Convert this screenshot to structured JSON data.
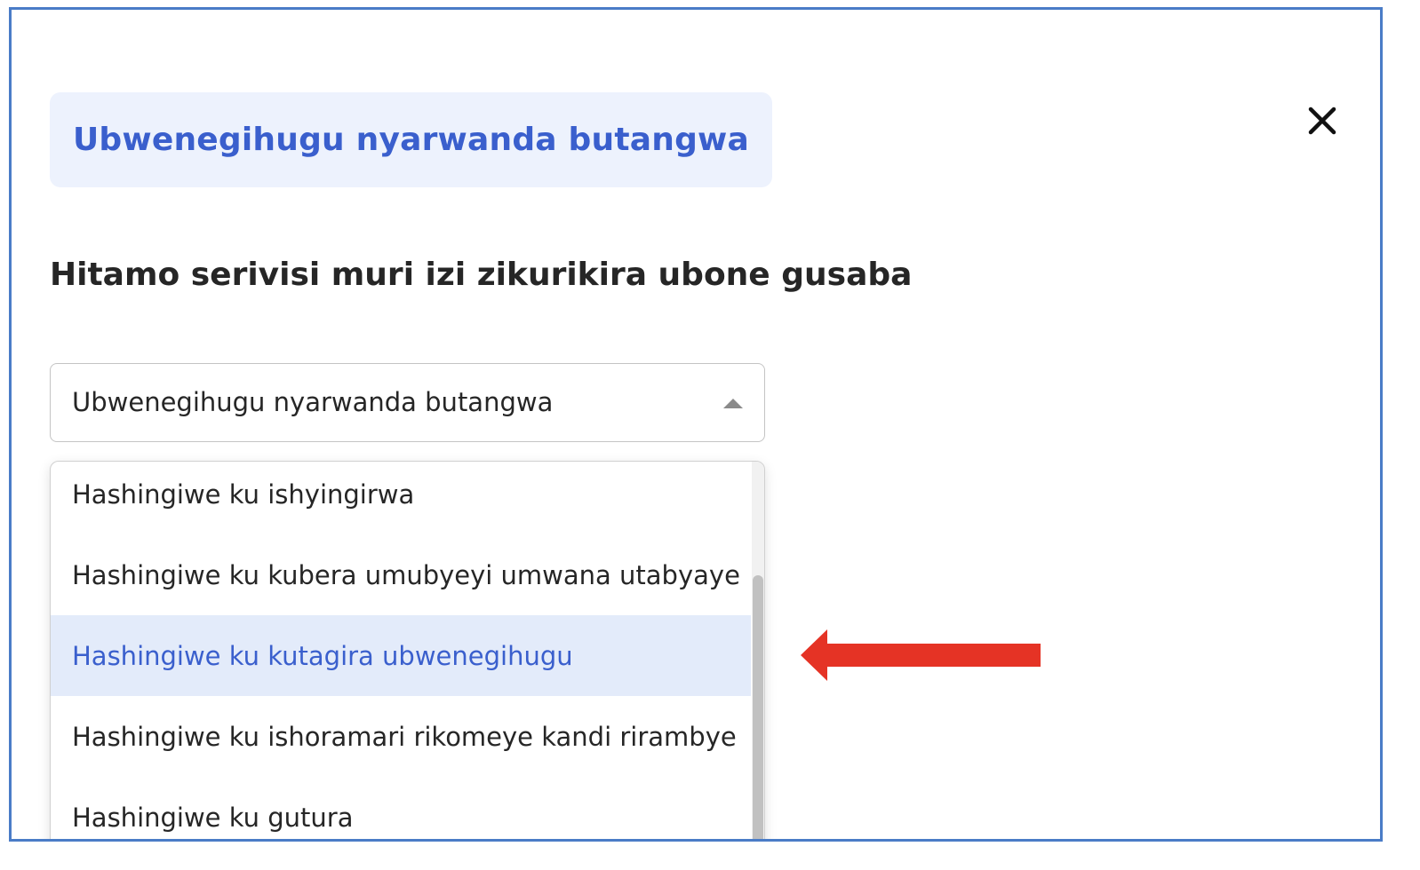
{
  "dialog": {
    "title": "Ubwenegihugu nyarwanda butangwa",
    "close_icon": "close-icon",
    "prompt": "Hitamo serivisi muri izi zikurikira ubone gusaba"
  },
  "service_select": {
    "selected_value": "Ubwenegihugu nyarwanda butangwa",
    "caret_icon": "caret-up-icon",
    "options": [
      {
        "label": "Hashingiwe ku ishyingirwa",
        "selected": false
      },
      {
        "label": "Hashingiwe ku kubera umubyeyi umwana utabyaye",
        "selected": false
      },
      {
        "label": "Hashingiwe ku kutagira ubwenegihugu",
        "selected": true
      },
      {
        "label": "Hashingiwe ku ishoramari rikomeye kandi rirambye",
        "selected": false
      },
      {
        "label": "Hashingiwe ku gutura",
        "selected": false
      }
    ]
  },
  "annotation": {
    "icon": "red-arrow-icon",
    "color": "#e53325"
  },
  "colors": {
    "accent": "#3a5fcd",
    "title_bg": "#edf2fd",
    "selected_bg": "#e3ebfa",
    "frame_border": "#4a7cc7"
  }
}
